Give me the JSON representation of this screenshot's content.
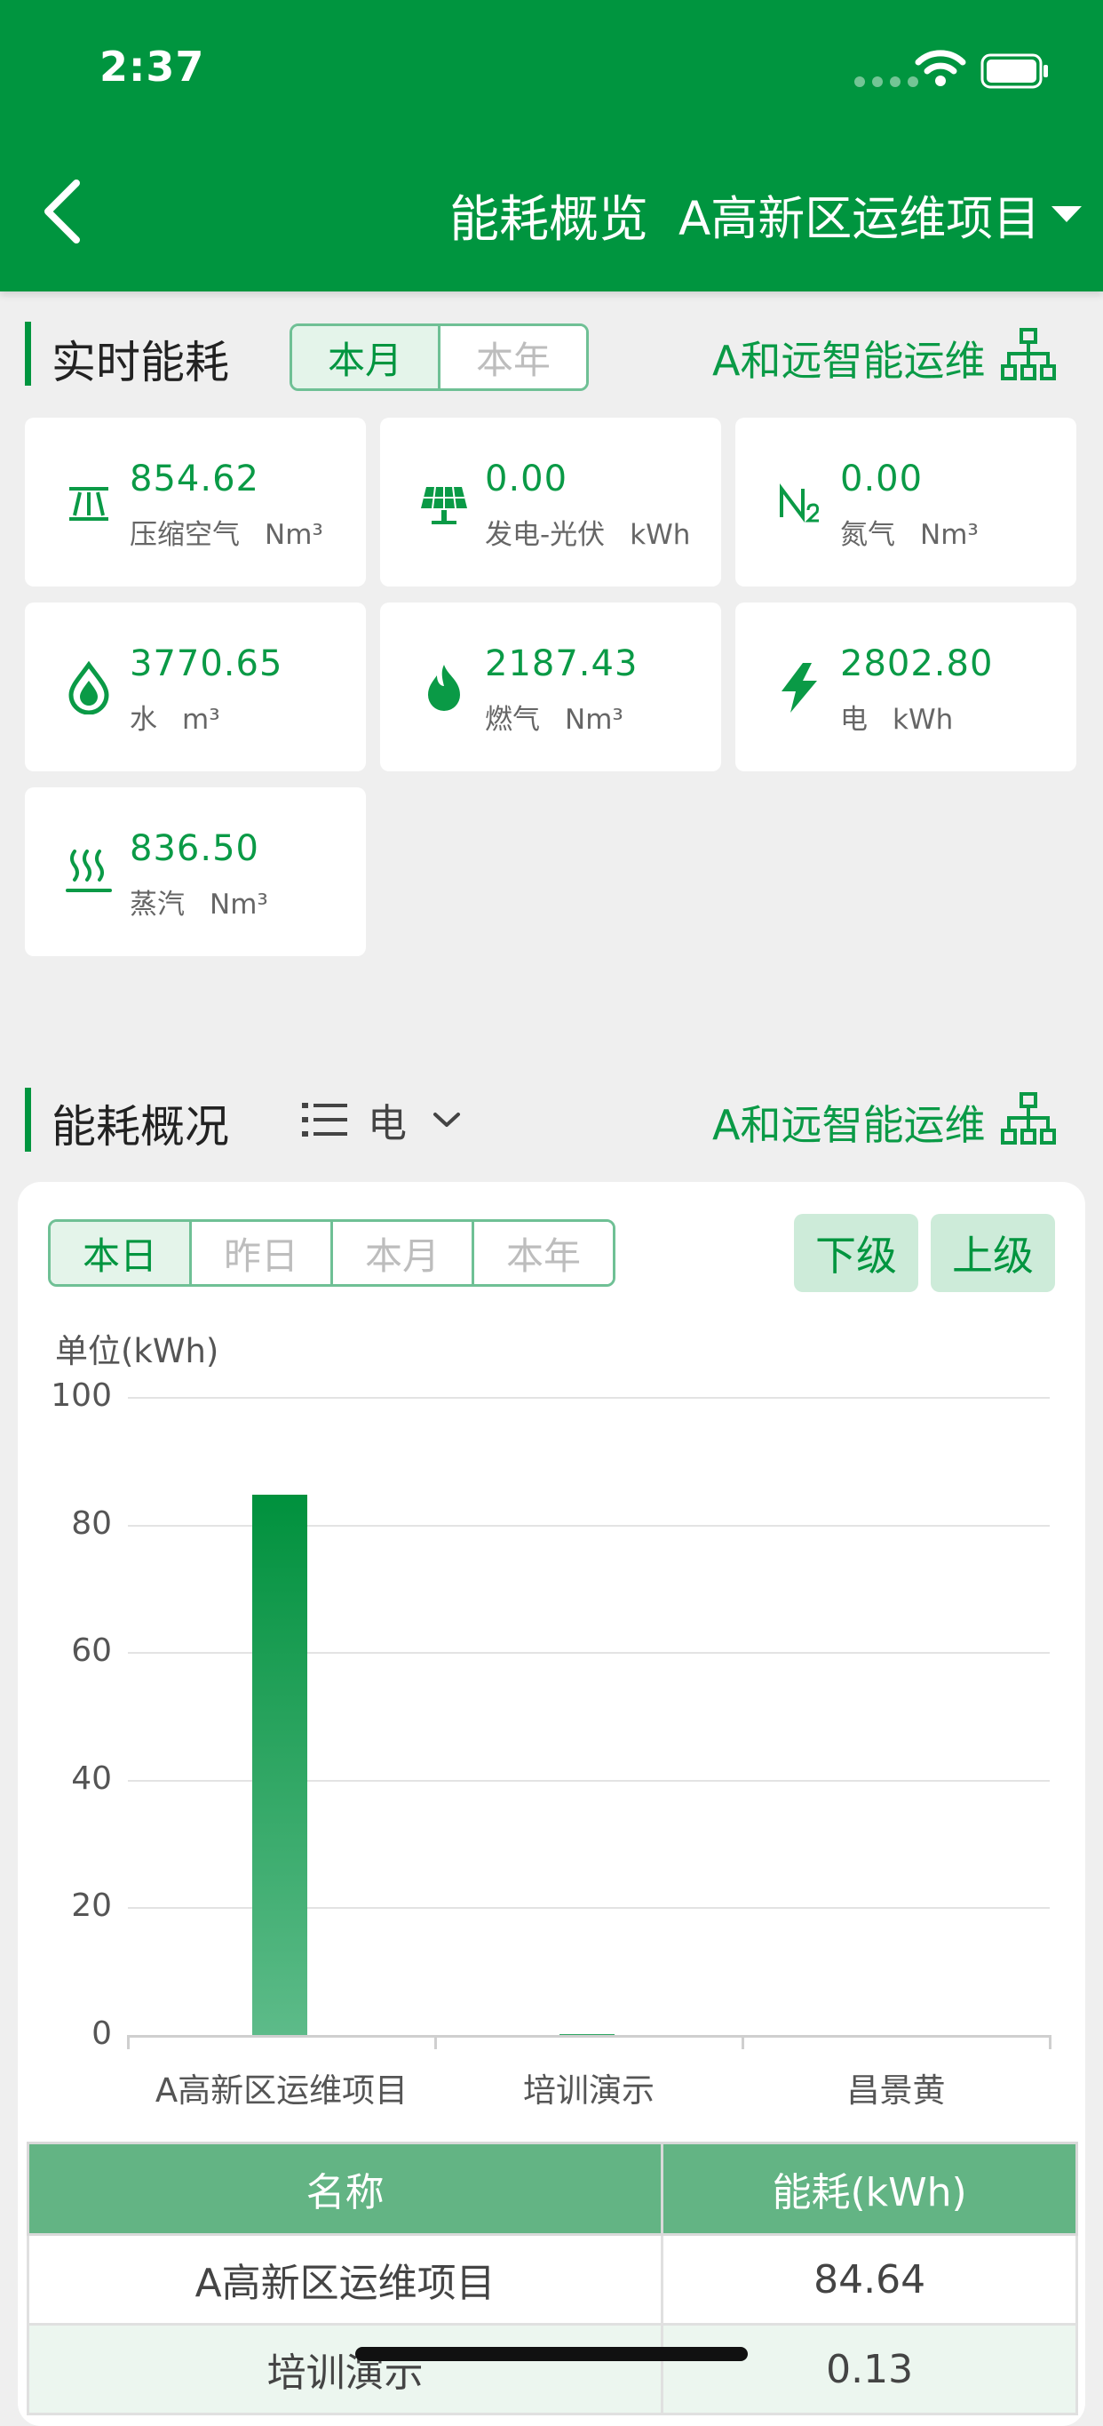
{
  "status_bar": {
    "time": "2:37"
  },
  "header": {
    "title": "能耗概览",
    "project": "A高新区运维项目"
  },
  "realtime": {
    "title": "实时能耗",
    "tabs": [
      "本月",
      "本年"
    ],
    "active_tab": "本月",
    "company": "A和远智能运维",
    "tiles": [
      {
        "icon": "compressed-air-icon",
        "value": "854.62",
        "name": "压缩空气",
        "unit": "Nm³"
      },
      {
        "icon": "solar-panel-icon",
        "value": "0.00",
        "name": "发电-光伏",
        "unit": "kWh"
      },
      {
        "icon": "nitrogen-icon",
        "value": "0.00",
        "name": "氮气",
        "unit": "Nm³"
      },
      {
        "icon": "water-drop-icon",
        "value": "3770.65",
        "name": "水",
        "unit": "m³"
      },
      {
        "icon": "flame-icon",
        "value": "2187.43",
        "name": "燃气",
        "unit": "Nm³"
      },
      {
        "icon": "lightning-icon",
        "value": "2802.80",
        "name": "电",
        "unit": "kWh"
      },
      {
        "icon": "steam-icon",
        "value": "836.50",
        "name": "蒸汽",
        "unit": "Nm³"
      }
    ]
  },
  "overview": {
    "title": "能耗概况",
    "energy_type": "电",
    "company": "A和远智能运维",
    "tabs": [
      "本日",
      "昨日",
      "本月",
      "本年"
    ],
    "active_tab": "本日",
    "down_label": "下级",
    "up_label": "上级",
    "unit_label": "单位(kWh)",
    "table": {
      "headers": [
        "名称",
        "能耗(kWh)"
      ],
      "rows": [
        [
          "A高新区运维项目",
          "84.64"
        ],
        [
          "培训演示",
          "0.13"
        ]
      ]
    }
  },
  "chart_data": {
    "type": "bar",
    "categories": [
      "A高新区运维项目",
      "培训演示",
      "昌景黄"
    ],
    "values": [
      84.64,
      0.13,
      0
    ],
    "ylabel": "单位(kWh)",
    "ylim": [
      0,
      100
    ],
    "yticks": [
      "0",
      "20",
      "40",
      "60",
      "80",
      "100"
    ],
    "grid": true
  },
  "colors": {
    "brand": "#00953f",
    "accent_light": "#cdebd9",
    "table_header": "#63b484"
  }
}
